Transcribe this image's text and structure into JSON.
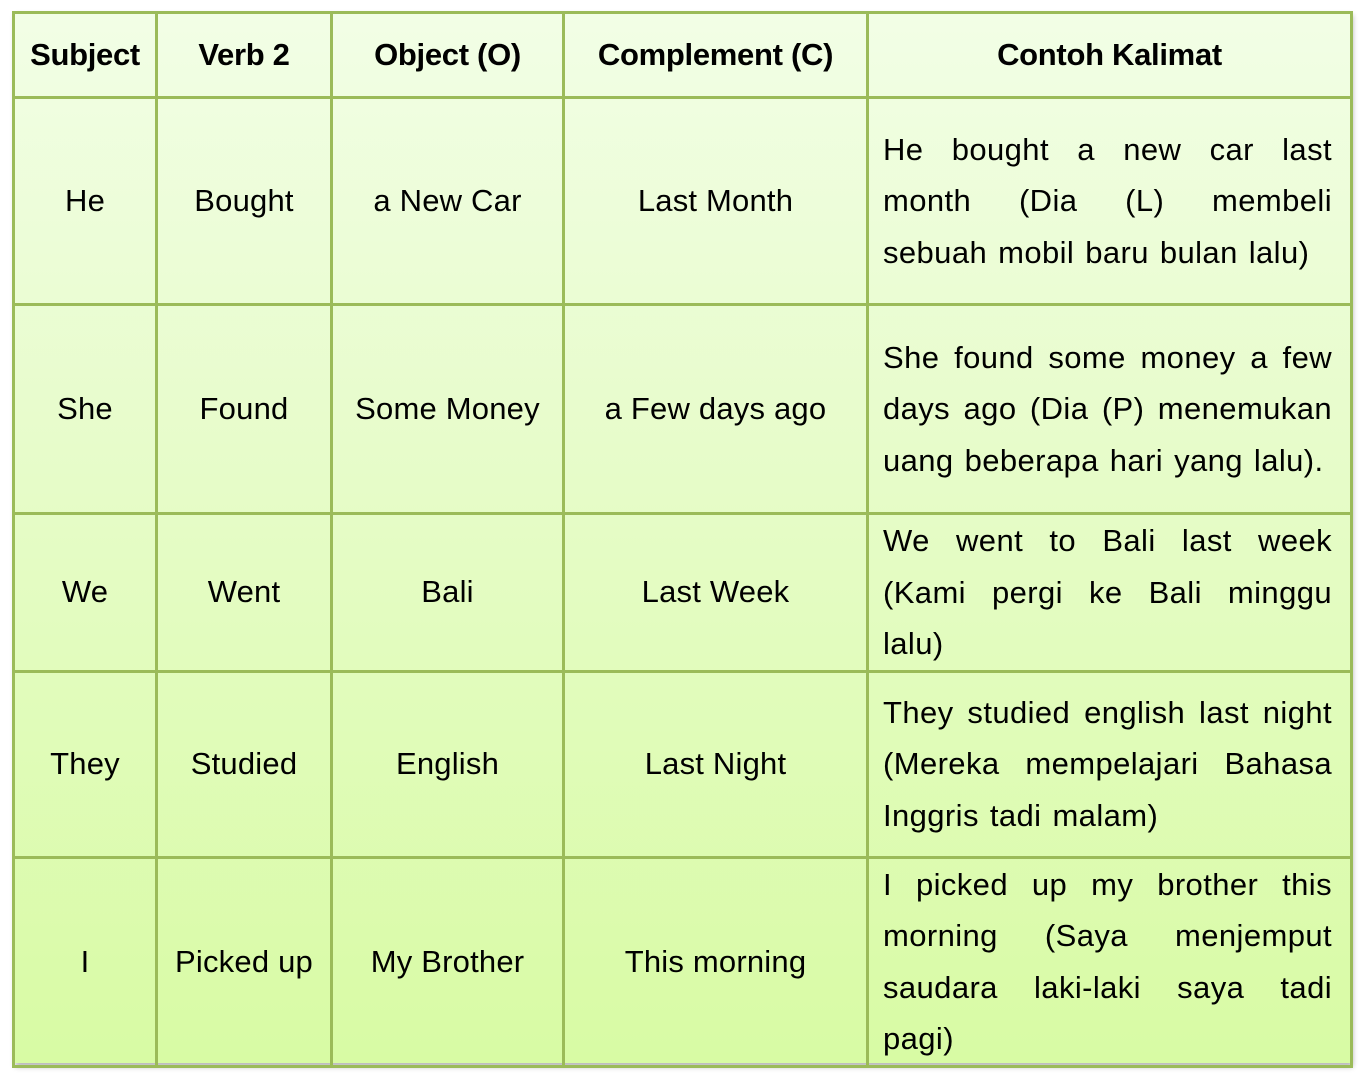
{
  "table": {
    "headers": [
      "Subject",
      "Verb 2",
      "Object (O)",
      "Complement (C)",
      "Contoh Kalimat"
    ],
    "rows": [
      {
        "subject": "He",
        "verb": "Bought",
        "object": "a New Car",
        "complement": "Last Month",
        "example": "He bought a new car last month (Dia (L) membeli sebuah mobil baru bulan lalu)"
      },
      {
        "subject": "She",
        "verb": "Found",
        "object": "Some Money",
        "complement": "a Few days ago",
        "example": "She found some money a few days ago (Dia (P) menemukan uang beberapa hari yang lalu)."
      },
      {
        "subject": "We",
        "verb": "Went",
        "object": "Bali",
        "complement": "Last Week",
        "example": "We went to Bali last week (Kami pergi ke Bali minggu lalu)"
      },
      {
        "subject": "They",
        "verb": "Studied",
        "object": "English",
        "complement": "Last Night",
        "example": "They studied english last night (Mereka mempelajari Bahasa Inggris tadi malam)"
      },
      {
        "subject": "I",
        "verb": "Picked up",
        "object": "My Brother",
        "complement": "This morning",
        "example": "I picked up my brother this morning (Saya menjemput saudara laki-laki saya tadi pagi)"
      }
    ]
  },
  "colors": {
    "border": "#9bbb59",
    "background_top": "#f2fee6",
    "background_bottom": "#d8fba4",
    "text": "#000000"
  }
}
